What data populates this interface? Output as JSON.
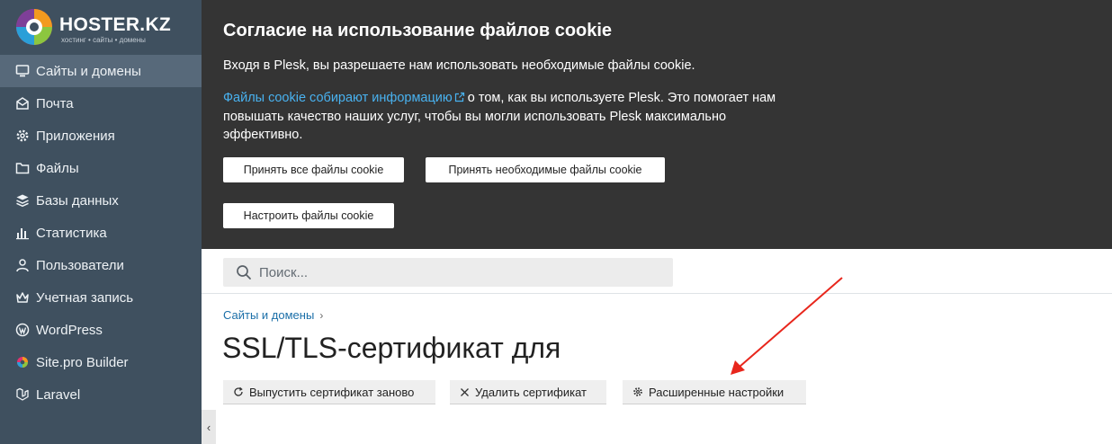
{
  "brand": {
    "title": "HOSTER.KZ",
    "subtitle": "хостинг • сайты • домены"
  },
  "sidebar": {
    "items": [
      {
        "label": "Сайты и домены",
        "icon": "monitor-icon",
        "active": true
      },
      {
        "label": "Почта",
        "icon": "mail-icon"
      },
      {
        "label": "Приложения",
        "icon": "gear-icon"
      },
      {
        "label": "Файлы",
        "icon": "folder-icon"
      },
      {
        "label": "Базы данных",
        "icon": "database-icon"
      },
      {
        "label": "Статистика",
        "icon": "bar-chart-icon"
      },
      {
        "label": "Пользователи",
        "icon": "user-icon"
      },
      {
        "label": "Учетная запись",
        "icon": "crown-icon"
      },
      {
        "label": "WordPress",
        "icon": "wordpress-icon"
      },
      {
        "label": "Site.pro Builder",
        "icon": "sitepro-icon"
      },
      {
        "label": "Laravel",
        "icon": "laravel-icon"
      }
    ],
    "collapse_glyph": "‹"
  },
  "cookie": {
    "title": "Согласие на использование файлов cookie",
    "text": "Входя в Plesk, вы разрешаете нам использовать необходимые файлы cookie.",
    "link": "Файлы cookie собирают информацию",
    "after_link": "о том, как вы используете Plesk. Это помогает нам повышать качество наших услуг, чтобы вы могли использовать Plesk максимально эффективно.",
    "accept_all": "Принять все файлы cookie",
    "accept_necessary": "Принять необходимые файлы cookie",
    "configure": "Настроить файлы cookie"
  },
  "search": {
    "placeholder": "Поиск..."
  },
  "breadcrumb": {
    "item": "Сайты и домены",
    "separator": "›"
  },
  "page": {
    "title": "SSL/TLS-сертификат для"
  },
  "actions": {
    "reissue": "Выпустить сертификат заново",
    "delete": "Удалить сертификат",
    "advanced": "Расширенные настройки"
  },
  "colors": {
    "sidebar": "#3f505f",
    "sidebar_active": "#57697a",
    "cookie_bg": "#343434",
    "link": "#1b6fa8",
    "annotation_arrow": "#e8261c"
  }
}
